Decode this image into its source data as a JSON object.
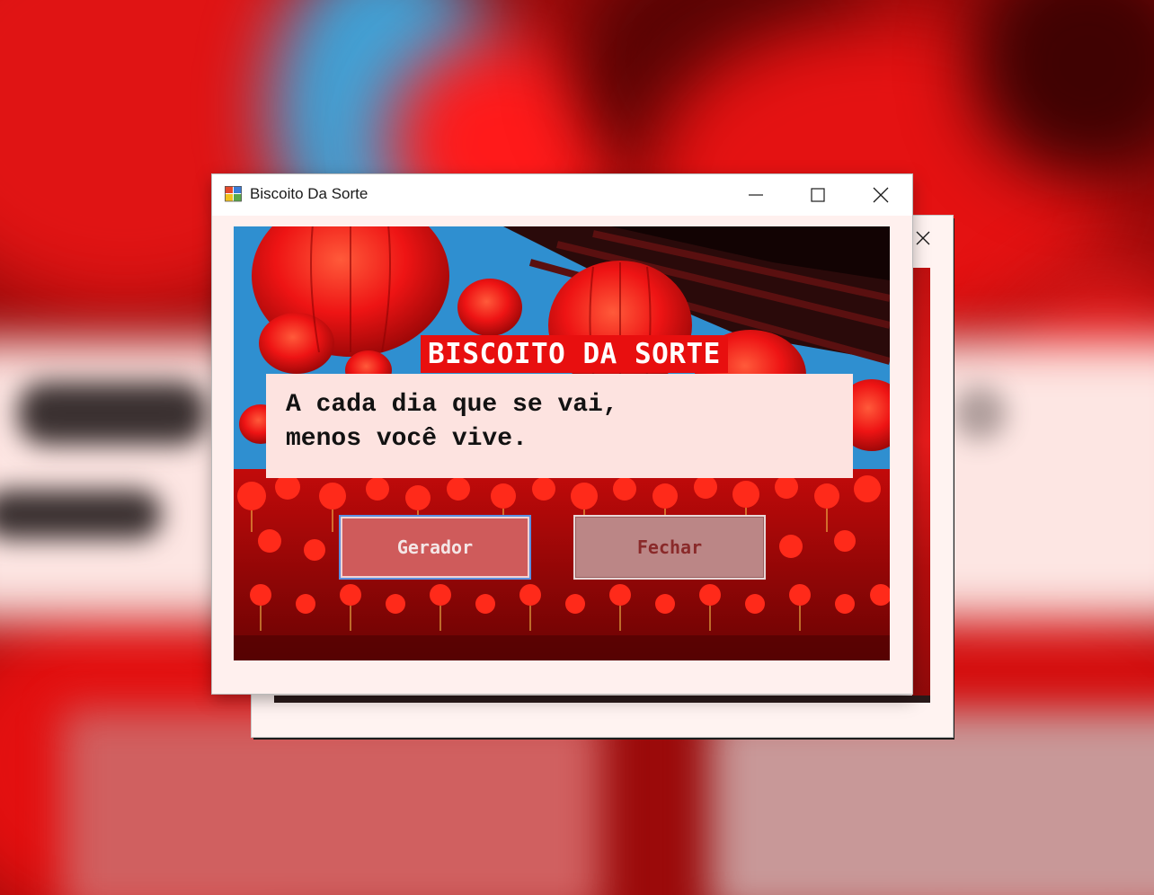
{
  "window": {
    "title": "Biscoito Da Sorte",
    "minimize_icon": "minimize-icon",
    "maximize_icon": "maximize-icon",
    "close_icon": "close-icon",
    "app_icon": "windows-forms-app-icon"
  },
  "content": {
    "banner": "BISCOITO DA SORTE",
    "quote": "A cada dia que se vai,\nmenos você vive.",
    "buttons": {
      "generate_label": "Gerador",
      "close_label": "Fechar"
    }
  },
  "background_window": {
    "close_icon": "close-icon"
  },
  "colors": {
    "accent_red": "#e80f0f",
    "generate_button": "#cf5b5b",
    "close_button": "#bb8686",
    "window_bg": "#fff0ee"
  }
}
